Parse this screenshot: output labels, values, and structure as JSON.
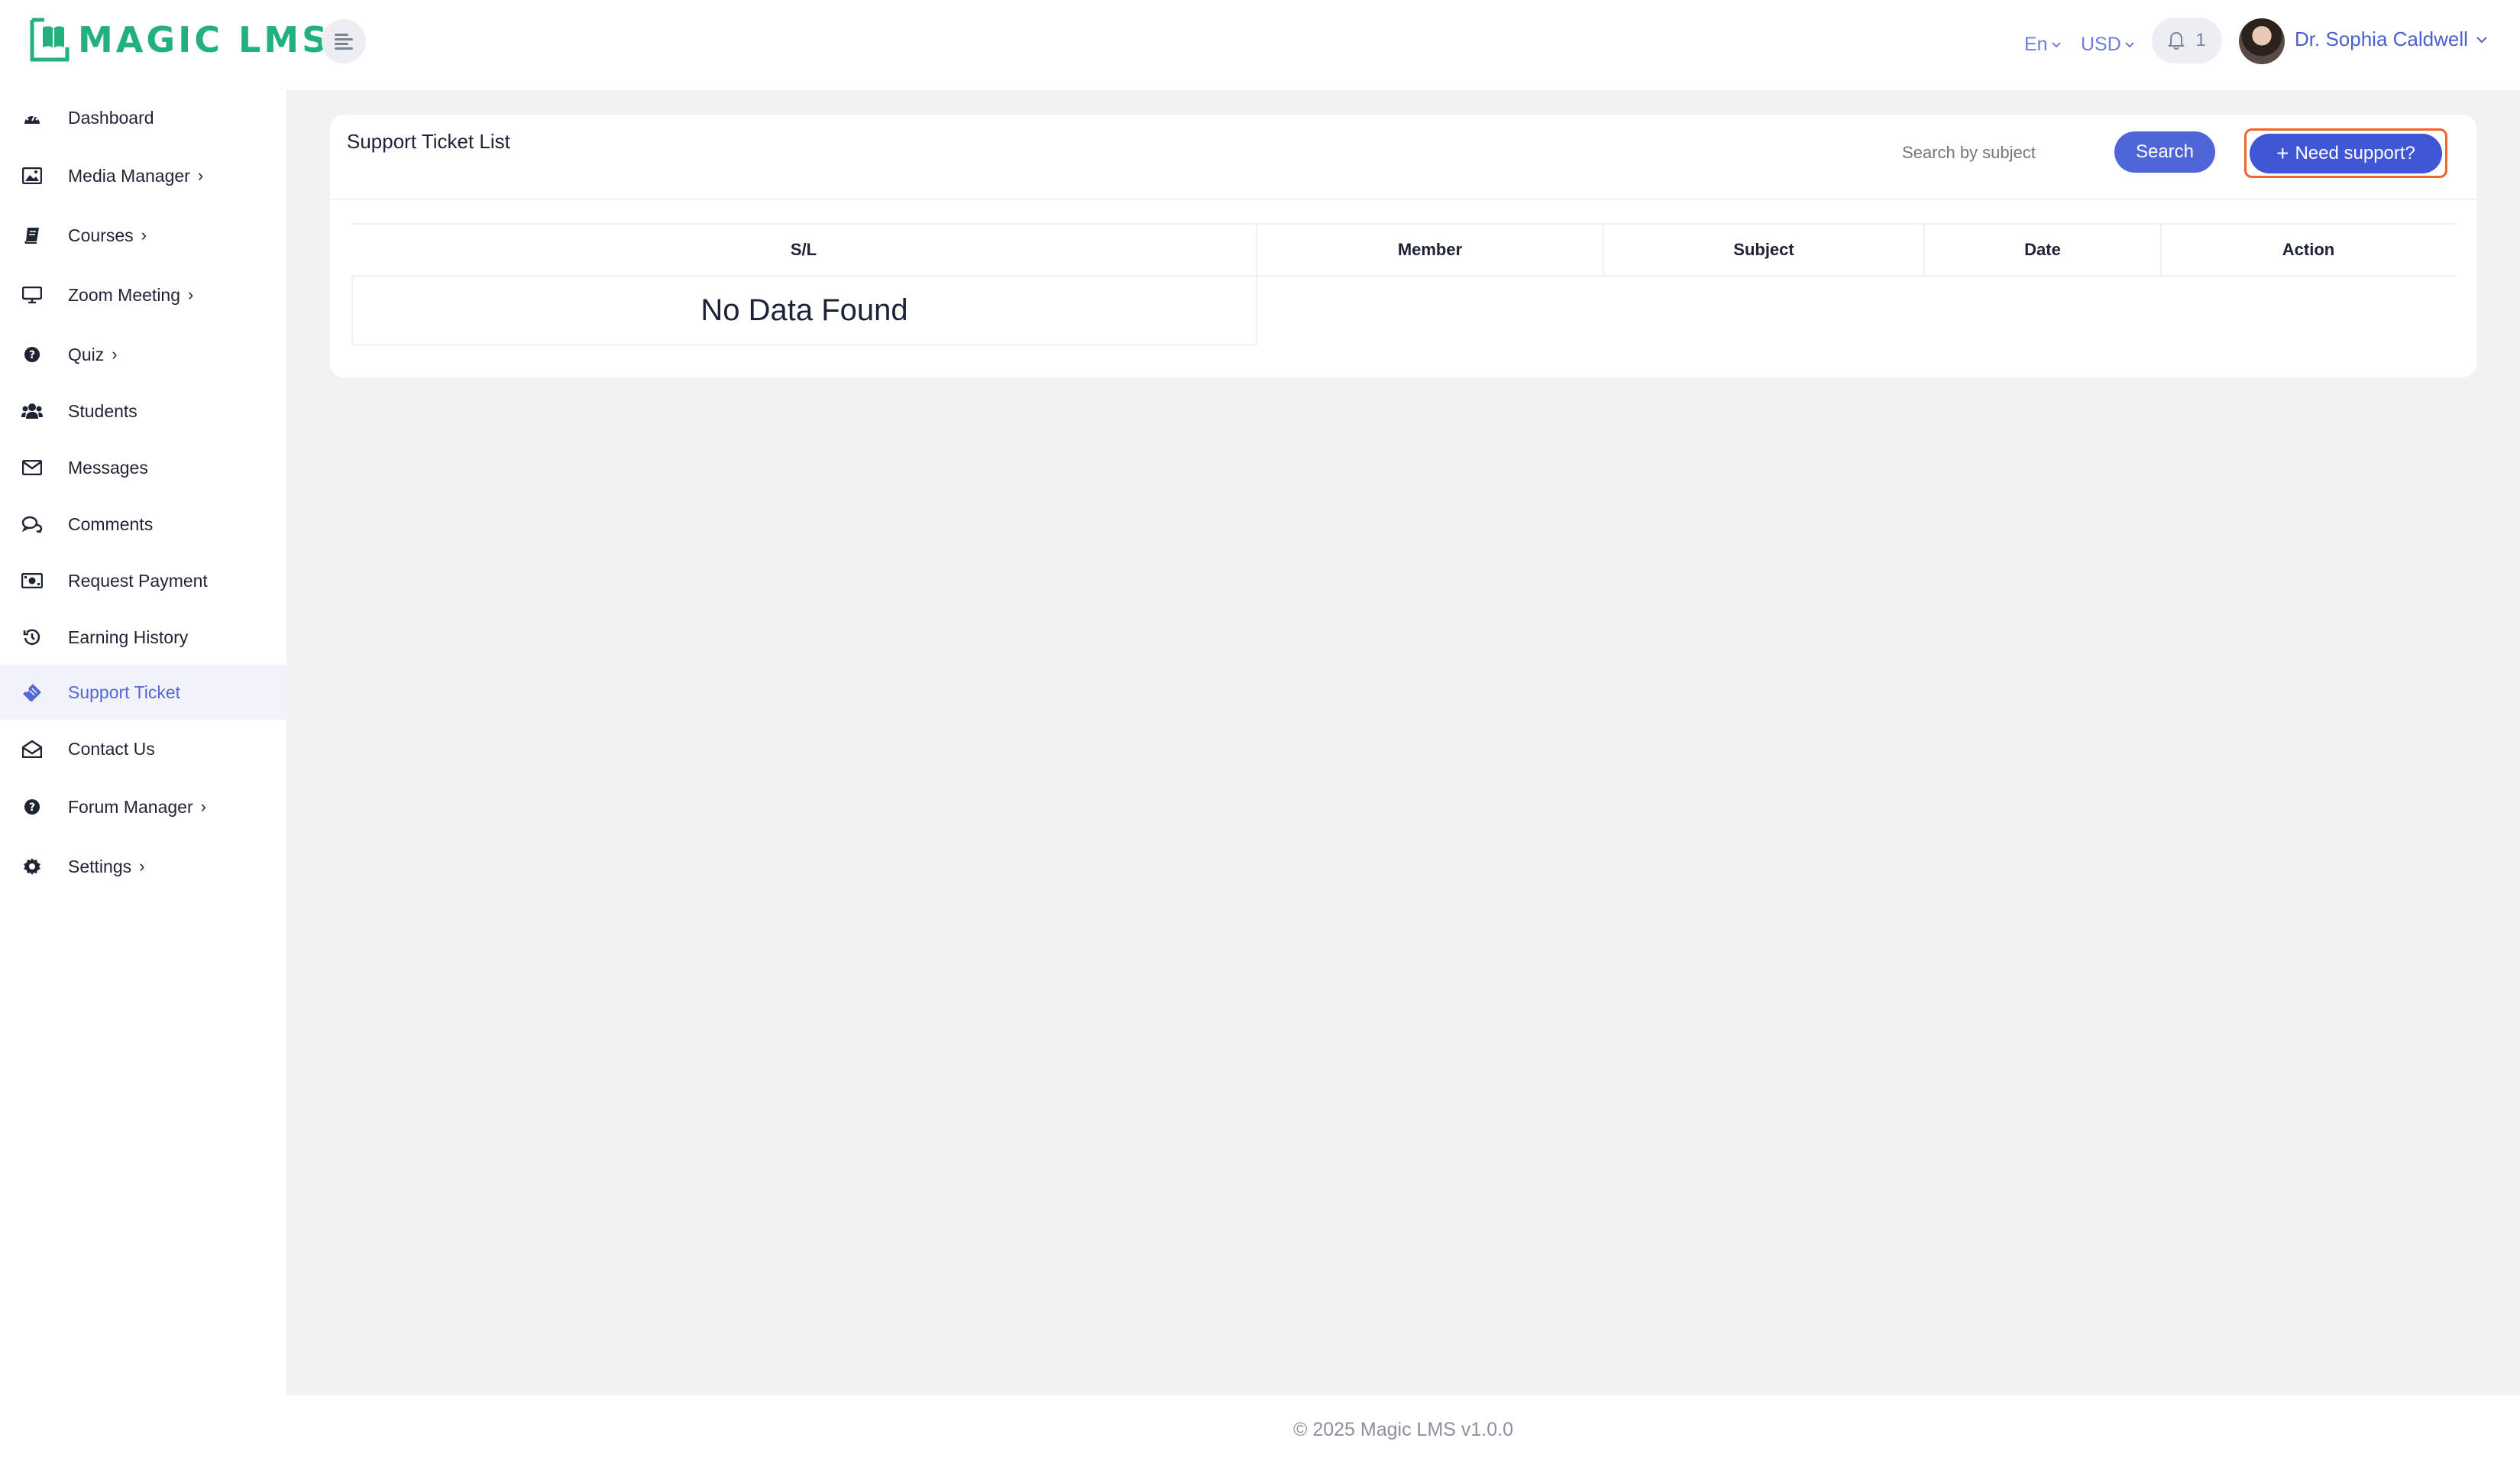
{
  "brand": {
    "name": "MAGIC LMS",
    "color": "#22b07d"
  },
  "header": {
    "language": "En",
    "currency": "USD",
    "notifications_count": "1",
    "user_name": "Dr. Sophia Caldwell"
  },
  "sidebar": {
    "items": [
      {
        "label": "Dashboard",
        "icon": "dashboard-icon",
        "has_submenu": false
      },
      {
        "label": "Media Manager",
        "icon": "image-icon",
        "has_submenu": true
      },
      {
        "label": "Courses",
        "icon": "book-icon",
        "has_submenu": true
      },
      {
        "label": "Zoom Meeting",
        "icon": "monitor-icon",
        "has_submenu": true
      },
      {
        "label": "Quiz",
        "icon": "question-icon",
        "has_submenu": true
      },
      {
        "label": "Students",
        "icon": "users-icon",
        "has_submenu": false
      },
      {
        "label": "Messages",
        "icon": "envelope-icon",
        "has_submenu": false
      },
      {
        "label": "Comments",
        "icon": "comments-icon",
        "has_submenu": false
      },
      {
        "label": "Request Payment",
        "icon": "money-icon",
        "has_submenu": false
      },
      {
        "label": "Earning History",
        "icon": "history-icon",
        "has_submenu": false
      },
      {
        "label": "Support Ticket",
        "icon": "ticket-icon",
        "has_submenu": false,
        "active": true
      },
      {
        "label": "Contact Us",
        "icon": "envelope-open-icon",
        "has_submenu": false
      },
      {
        "label": "Forum Manager",
        "icon": "question-icon",
        "has_submenu": true
      },
      {
        "label": "Settings",
        "icon": "gear-icon",
        "has_submenu": true
      }
    ]
  },
  "main": {
    "title": "Support Ticket List",
    "search_placeholder": "Search by subject",
    "search_button": "Search",
    "need_support_button": "Need support?",
    "table": {
      "columns": [
        "S/L",
        "Member",
        "Subject",
        "Date",
        "Action"
      ],
      "empty_message": "No Data Found"
    }
  },
  "footer": {
    "text": "© 2025 Magic LMS v1.0.0"
  },
  "colors": {
    "accent": "#4f66d8",
    "highlight": "#f0642c",
    "active_bg": "#f2f2fb"
  }
}
